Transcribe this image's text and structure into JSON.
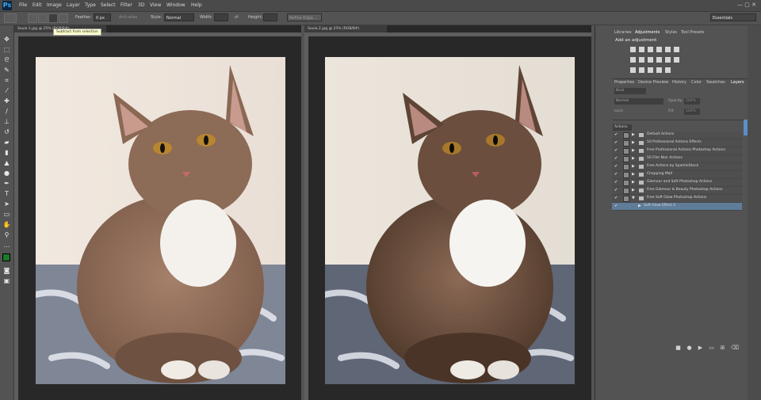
{
  "app": {
    "logo": "Ps"
  },
  "menu": [
    "File",
    "Edit",
    "Image",
    "Layer",
    "Type",
    "Select",
    "Filter",
    "3D",
    "View",
    "Window",
    "Help"
  ],
  "options": {
    "feather_label": "Feather:",
    "feather_value": "0 px",
    "antialias_label": "Anti-alias",
    "style_label": "Style:",
    "style_value": "Normal",
    "width_label": "Width:",
    "height_label": "Height:",
    "refine_edge": "Refine Edge...",
    "workspace": "Essentials",
    "tooltip": "Subtract from selection"
  },
  "documents": [
    {
      "tab": "Soula 1.jpg @ 25% (RGB/8#)"
    },
    {
      "tab": "Soula 2.jpg @ 25% (RGB/8#)"
    }
  ],
  "panels": {
    "top_tabs": [
      "Libraries",
      "Adjustments",
      "Styles",
      "Tool Presets"
    ],
    "adjust_heading": "Add an adjustment",
    "bottom_tabs": [
      "Properties",
      "Device Preview",
      "History",
      "Color",
      "Swatches",
      "Layers"
    ],
    "kind_label": "Kind",
    "blend_mode": "Normal",
    "opacity_label": "Opacity:",
    "opacity_value": "100%",
    "lock_label": "Lock:",
    "fill_label": "Fill:",
    "fill_value": "100%",
    "actions_dropdown": "Actions",
    "layers": [
      "Default Actions",
      "50 Professional Actions Effects",
      "Free Professional Actions Photoshop Actions",
      "50 Film Noir Actions",
      "Free Actions by SparkleStock",
      "Chopping Mall",
      "Glamour and Soft Photoshop Actions",
      "Free Glamour & Beauty Photoshop Actions",
      "Free Soft Glow Photoshop Actions",
      "Soft Glow Effect 2"
    ]
  },
  "colors": {
    "foreground": "#1a7a2a",
    "background": "#ffffff",
    "selected_row": "#5f7c99"
  }
}
